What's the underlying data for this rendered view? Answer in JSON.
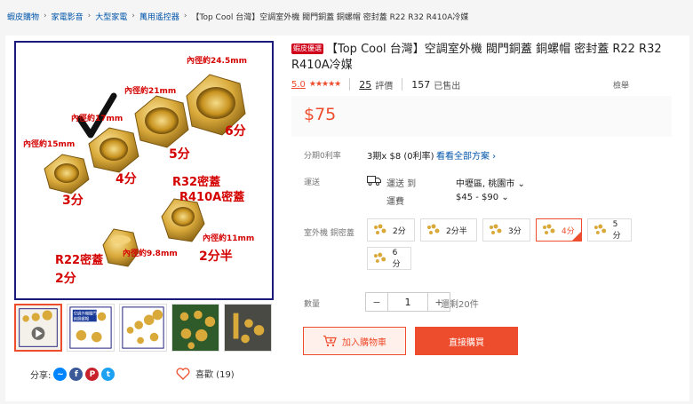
{
  "breadcrumb": {
    "items": [
      "蝦皮購物",
      "家電影音",
      "大型家電",
      "萬用遙控器"
    ],
    "current": "【Top Cool 台灣】空調室外機 閥門銅蓋 銅螺帽 密封蓋 R22 R32 R410A冷媒"
  },
  "main_image": {
    "labels": {
      "size15": "內徑約15mm",
      "size17": "內徑約17mm",
      "size21": "內徑約21mm",
      "size245": "內徑約24.5mm",
      "size11": "內徑約11mm",
      "size98": "內徑約9.8mm",
      "fen3": "3分",
      "fen4": "4分",
      "fen5": "5分",
      "fen6": "6分",
      "r32a": "R32密蓋",
      "r32b": "R410A密蓋",
      "fen2half": "2分半",
      "r22": "R22密蓋",
      "fen2": "2分"
    }
  },
  "thumbnails": {
    "thumb2_line1": "空調外機閥門",
    "thumb2_line2": "純銅螺帽"
  },
  "share": {
    "label": "分享:"
  },
  "like": {
    "label": "喜歡 (19)"
  },
  "product": {
    "badge": "蝦皮優選",
    "title": "【Top Cool 台灣】空調室外機 閥門銅蓋 銅螺帽 密封蓋 R22 R32 R410A冷媒"
  },
  "rating": {
    "score": "5.0",
    "stars": "★★★★★",
    "reviews_count": "25",
    "reviews_label": "評價",
    "sold_count": "157",
    "sold_label": "已售出",
    "report": "檢舉"
  },
  "price": "$75",
  "installment": {
    "label": "分期0利率",
    "value": "3期x $8 (0利率)",
    "link": "看看全部方案 ›"
  },
  "shipping": {
    "label": "運送",
    "to_label": "運送 到",
    "location": "中壢區, 桃園市 ⌄",
    "fee_label": "運費",
    "fee": "$45 - $90 ⌄"
  },
  "variation": {
    "label": "室外機 銅密蓋",
    "options": [
      "2分",
      "2分半",
      "3分",
      "4分",
      "5分",
      "6分"
    ],
    "selected": "4分"
  },
  "quantity": {
    "label": "數量",
    "minus": "−",
    "value": "1",
    "plus": "+",
    "stock": "還剩20件"
  },
  "buttons": {
    "add_to_cart": "加入購物車",
    "buy_now": "直接購買"
  },
  "colors": {
    "accent": "#ee4d2d",
    "label_red": "#d40000",
    "brass": "#d9a93a",
    "link": "#0055aa"
  }
}
